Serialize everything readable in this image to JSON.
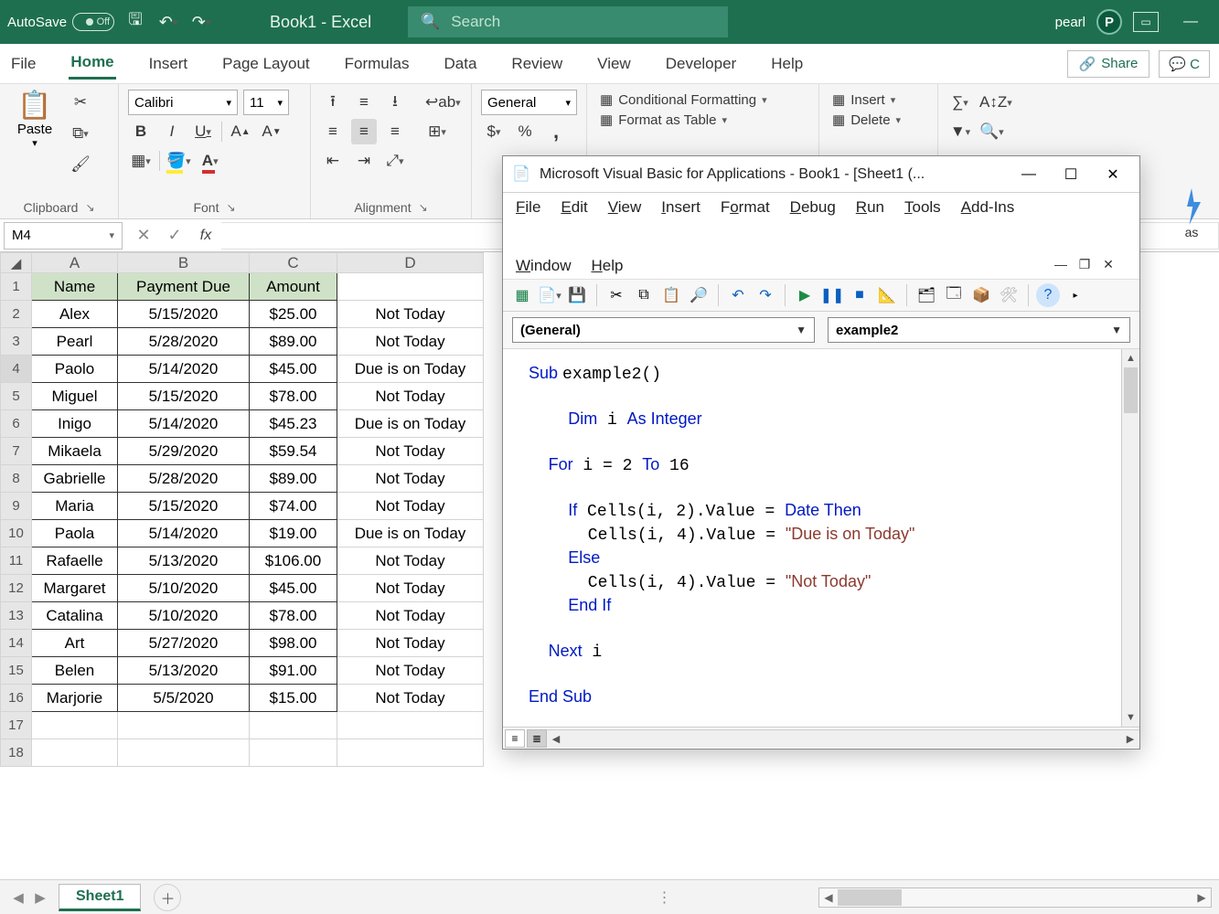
{
  "titlebar": {
    "autosave": "AutoSave",
    "toggle": "Off",
    "title": "Book1 - Excel",
    "search_placeholder": "Search",
    "username": "pearl",
    "avatar_initial": "P"
  },
  "ribbon_tabs": [
    "File",
    "Home",
    "Insert",
    "Page Layout",
    "Formulas",
    "Data",
    "Review",
    "View",
    "Developer",
    "Help"
  ],
  "ribbon_active": "Home",
  "share": "Share",
  "comments": "C",
  "clipboard": {
    "paste": "Paste",
    "group": "Clipboard"
  },
  "font": {
    "name": "Calibri",
    "size": "11",
    "group": "Font"
  },
  "alignment": {
    "group": "Alignment"
  },
  "number": {
    "format": "General"
  },
  "styles": {
    "conditional": "Conditional Formatting",
    "table": "Format as Table"
  },
  "cells": {
    "insert": "Insert",
    "delete": "Delete"
  },
  "ideas": "as",
  "formula_bar": {
    "namebox": "M4"
  },
  "columns": [
    "A",
    "B",
    "C",
    "D"
  ],
  "headers": {
    "A": "Name",
    "B": "Payment Due",
    "C": "Amount"
  },
  "rows": [
    {
      "n": "2",
      "A": "Alex",
      "B": "5/15/2020",
      "C": "$25.00",
      "D": "Not Today"
    },
    {
      "n": "3",
      "A": "Pearl",
      "B": "5/28/2020",
      "C": "$89.00",
      "D": "Not Today"
    },
    {
      "n": "4",
      "A": "Paolo",
      "B": "5/14/2020",
      "C": "$45.00",
      "D": "Due is on Today"
    },
    {
      "n": "5",
      "A": "Miguel",
      "B": "5/15/2020",
      "C": "$78.00",
      "D": "Not Today"
    },
    {
      "n": "6",
      "A": "Inigo",
      "B": "5/14/2020",
      "C": "$45.23",
      "D": "Due is on Today"
    },
    {
      "n": "7",
      "A": "Mikaela",
      "B": "5/29/2020",
      "C": "$59.54",
      "D": "Not Today"
    },
    {
      "n": "8",
      "A": "Gabrielle",
      "B": "5/28/2020",
      "C": "$89.00",
      "D": "Not Today"
    },
    {
      "n": "9",
      "A": "Maria",
      "B": "5/15/2020",
      "C": "$74.00",
      "D": "Not Today"
    },
    {
      "n": "10",
      "A": "Paola",
      "B": "5/14/2020",
      "C": "$19.00",
      "D": "Due is on Today"
    },
    {
      "n": "11",
      "A": "Rafaelle",
      "B": "5/13/2020",
      "C": "$106.00",
      "D": "Not Today"
    },
    {
      "n": "12",
      "A": "Margaret",
      "B": "5/10/2020",
      "C": "$45.00",
      "D": "Not Today"
    },
    {
      "n": "13",
      "A": "Catalina",
      "B": "5/10/2020",
      "C": "$78.00",
      "D": "Not Today"
    },
    {
      "n": "14",
      "A": "Art",
      "B": "5/27/2020",
      "C": "$98.00",
      "D": "Not Today"
    },
    {
      "n": "15",
      "A": "Belen",
      "B": "5/13/2020",
      "C": "$91.00",
      "D": "Not Today"
    },
    {
      "n": "16",
      "A": "Marjorie",
      "B": "5/5/2020",
      "C": "$15.00",
      "D": "Not Today"
    }
  ],
  "empty_rows": [
    "17",
    "18"
  ],
  "sheet_tab": "Sheet1",
  "vba": {
    "title": "Microsoft Visual Basic for Applications - Book1 - [Sheet1 (...",
    "menus": [
      "File",
      "Edit",
      "View",
      "Insert",
      "Format",
      "Debug",
      "Run",
      "Tools",
      "Add-Ins",
      "Window",
      "Help"
    ],
    "object_dd": "(General)",
    "proc_dd": "example2",
    "code_lines": [
      {
        "t": "kw",
        "v": "Sub "
      },
      {
        "t": "",
        "v": "example2()"
      },
      {
        "t": "br"
      },
      {
        "t": "br"
      },
      {
        "t": "",
        "v": "    "
      },
      {
        "t": "kw",
        "v": "Dim"
      },
      {
        "t": "",
        "v": " i "
      },
      {
        "t": "kw",
        "v": "As Integer"
      },
      {
        "t": "br"
      },
      {
        "t": "br"
      },
      {
        "t": "",
        "v": "  "
      },
      {
        "t": "kw",
        "v": "For"
      },
      {
        "t": "",
        "v": " i = 2 "
      },
      {
        "t": "kw",
        "v": "To"
      },
      {
        "t": "",
        "v": " 16"
      },
      {
        "t": "br"
      },
      {
        "t": "br"
      },
      {
        "t": "",
        "v": "    "
      },
      {
        "t": "kw",
        "v": "If"
      },
      {
        "t": "",
        "v": " Cells(i, 2).Value = "
      },
      {
        "t": "kw",
        "v": "Date Then"
      },
      {
        "t": "br"
      },
      {
        "t": "",
        "v": "      Cells(i, 4).Value = "
      },
      {
        "t": "str",
        "v": "\"Due is on Today\""
      },
      {
        "t": "br"
      },
      {
        "t": "",
        "v": "    "
      },
      {
        "t": "kw",
        "v": "Else"
      },
      {
        "t": "br"
      },
      {
        "t": "",
        "v": "      Cells(i, 4).Value = "
      },
      {
        "t": "str",
        "v": "\"Not Today\""
      },
      {
        "t": "br"
      },
      {
        "t": "",
        "v": "    "
      },
      {
        "t": "kw",
        "v": "End If"
      },
      {
        "t": "br"
      },
      {
        "t": "br"
      },
      {
        "t": "",
        "v": "  "
      },
      {
        "t": "kw",
        "v": "Next"
      },
      {
        "t": "",
        "v": " i"
      },
      {
        "t": "br"
      },
      {
        "t": "br"
      },
      {
        "t": "kw",
        "v": "End Sub"
      }
    ]
  }
}
